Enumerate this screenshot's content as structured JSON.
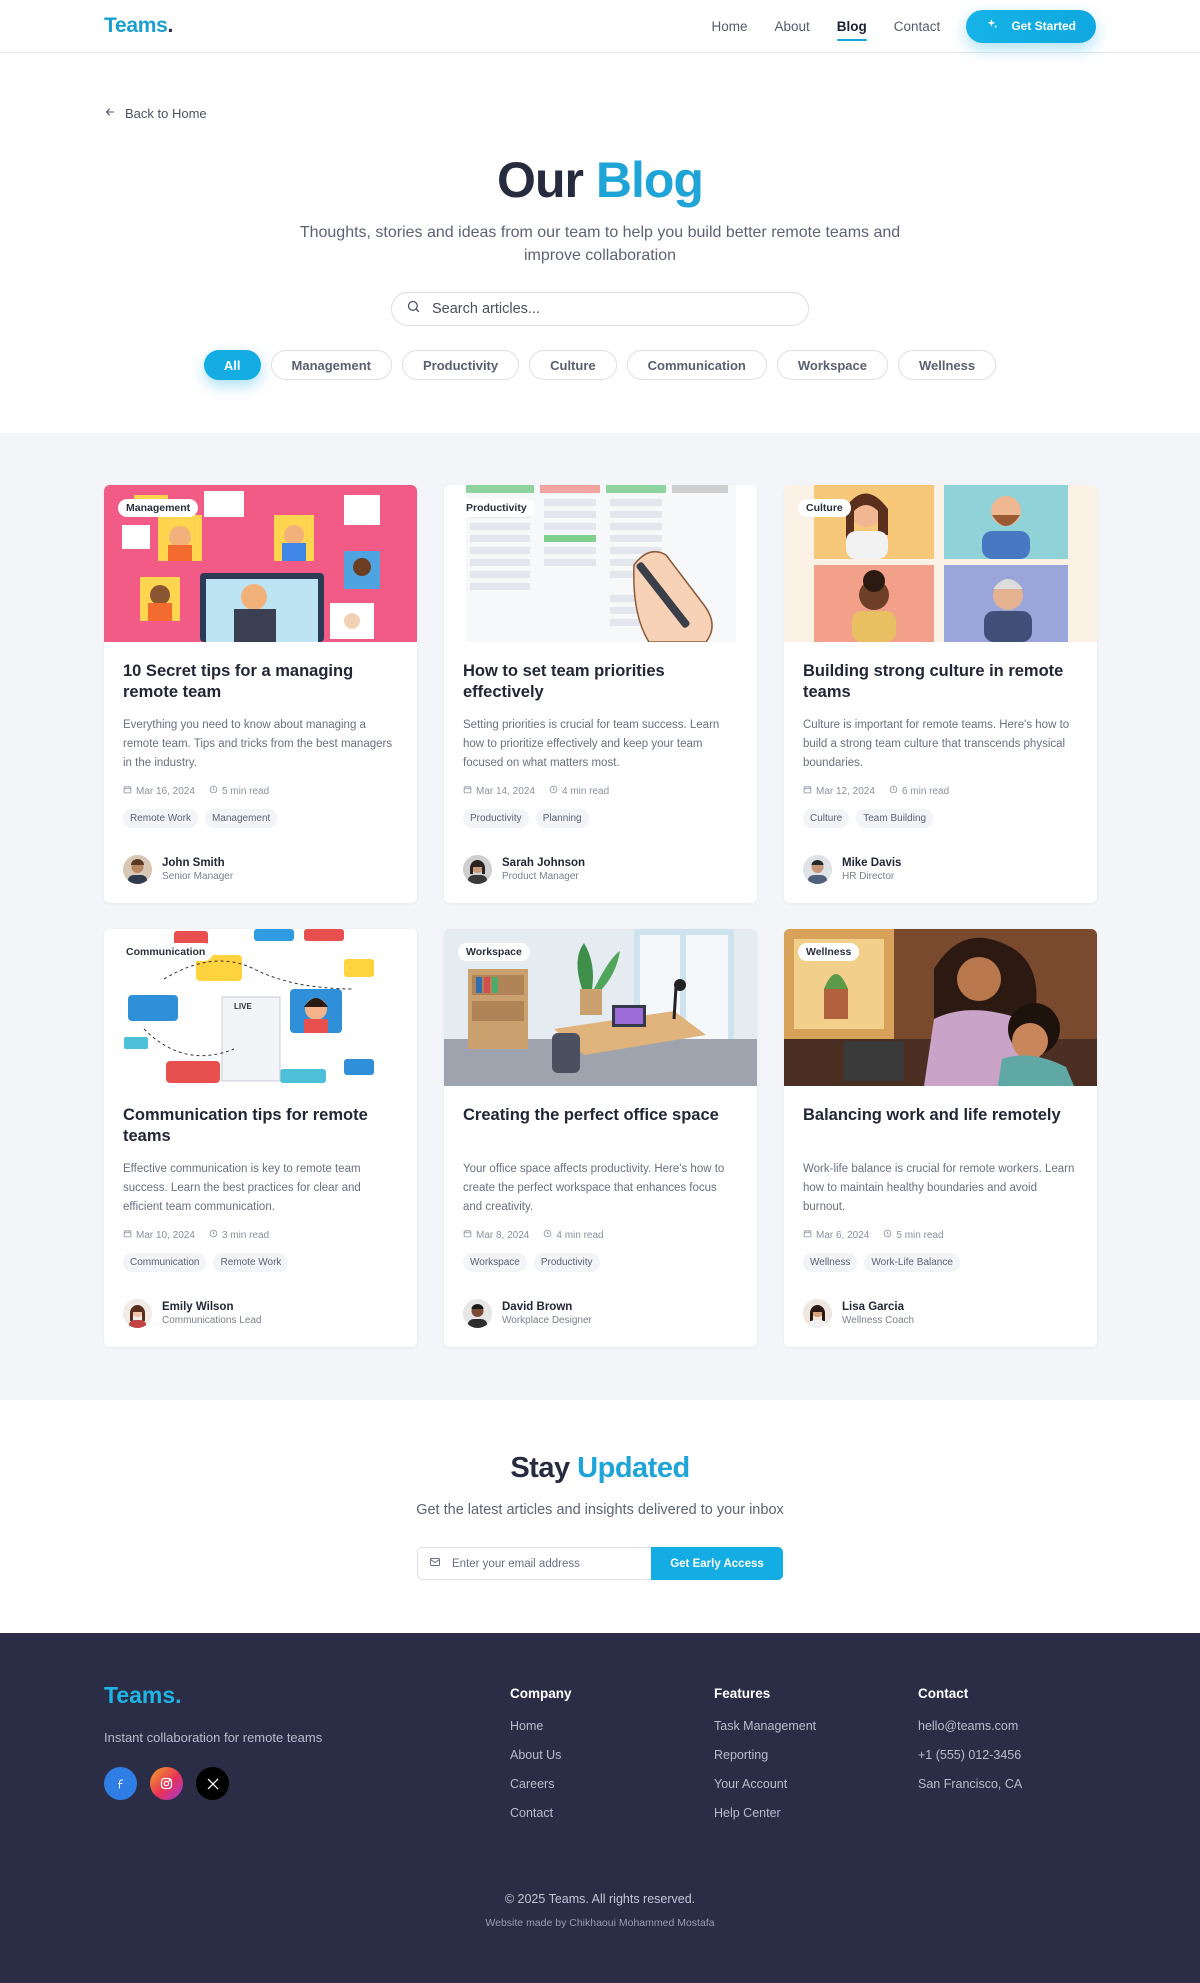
{
  "nav": {
    "logo": "Teams",
    "logo_dot": ".",
    "links": [
      "Home",
      "About",
      "Blog",
      "Contact"
    ],
    "active": "Blog",
    "cta": "Get Started"
  },
  "hero": {
    "back": "Back to Home",
    "title_main": "Our",
    "title_accent": "Blog",
    "subtitle": "Thoughts, stories and ideas from our team to help you build better remote teams and improve collaboration",
    "search_placeholder": "Search articles...",
    "filters": [
      "All",
      "Management",
      "Productivity",
      "Culture",
      "Communication",
      "Workspace",
      "Wellness"
    ],
    "active_filter": "All"
  },
  "posts": [
    {
      "category": "Management",
      "title": "10 Secret tips for a managing remote team",
      "excerpt": "Everything you need to know about managing a remote team. Tips and tricks from the best managers in the industry.",
      "date": "Mar 16, 2024",
      "read": "5 min read",
      "tags": [
        "Remote Work",
        "Management"
      ],
      "author": "John Smith",
      "role": "Senior Manager",
      "thumb_bg": "#f0547e"
    },
    {
      "category": "Productivity",
      "title": "How to set team priorities effectively",
      "excerpt": "Setting priorities is crucial for team success. Learn how to prioritize effectively and keep your team focused on what matters most.",
      "date": "Mar 14, 2024",
      "read": "4 min read",
      "tags": [
        "Productivity",
        "Planning"
      ],
      "author": "Sarah Johnson",
      "role": "Product Manager",
      "thumb_bg": "#ffffff"
    },
    {
      "category": "Culture",
      "title": "Building strong culture in remote teams",
      "excerpt": "Culture is important for remote teams. Here's how to build a strong team culture that transcends physical boundaries.",
      "date": "Mar 12, 2024",
      "read": "6 min read",
      "tags": [
        "Culture",
        "Team Building"
      ],
      "author": "Mike Davis",
      "role": "HR Director",
      "thumb_bg": "#fbe9d6"
    },
    {
      "category": "Communication",
      "title": "Communication tips for remote teams",
      "excerpt": "Effective communication is key to remote team success. Learn the best practices for clear and efficient team communication.",
      "date": "Mar 10, 2024",
      "read": "3 min read",
      "tags": [
        "Communication",
        "Remote Work"
      ],
      "author": "Emily Wilson",
      "role": "Communications Lead",
      "thumb_bg": "#ffffff"
    },
    {
      "category": "Workspace",
      "title": "Creating the perfect office space",
      "excerpt": "Your office space affects productivity. Here's how to create the perfect workspace that enhances focus and creativity.",
      "date": "Mar 8, 2024",
      "read": "4 min read",
      "tags": [
        "Workspace",
        "Productivity"
      ],
      "author": "David Brown",
      "role": "Workplace Designer",
      "thumb_bg": "#dfe8ee"
    },
    {
      "category": "Wellness",
      "title": "Balancing work and life remotely",
      "excerpt": "Work-life balance is crucial for remote workers. Learn how to maintain healthy boundaries and avoid burnout.",
      "date": "Mar 6, 2024",
      "read": "5 min read",
      "tags": [
        "Wellness",
        "Work-Life Balance"
      ],
      "author": "Lisa Garcia",
      "role": "Wellness Coach",
      "thumb_bg": "#7a4a2e"
    }
  ],
  "newsletter": {
    "title_main": "Stay",
    "title_accent": "Updated",
    "subtitle": "Get the latest articles and insights delivered to your inbox",
    "email_placeholder": "Enter your email address",
    "button": "Get Early Access"
  },
  "footer": {
    "logo": "Teams.",
    "tagline": "Instant collaboration for remote teams",
    "columns": [
      {
        "title": "Company",
        "links": [
          "Home",
          "About Us",
          "Careers",
          "Contact"
        ]
      },
      {
        "title": "Features",
        "links": [
          "Task Management",
          "Reporting",
          "Your Account",
          "Help Center"
        ]
      },
      {
        "title": "Contact",
        "links": [
          "hello@teams.com",
          "+1 (555) 012-3456",
          "San Francisco, CA"
        ]
      }
    ],
    "copyright": "© 2025 Teams. All rights reserved.",
    "credit": "Website made by Chikhaoui Mohammed Mostafa"
  },
  "colors": {
    "accent": "#14ade3",
    "text_dark": "#262b3f",
    "footer_bg": "#2b2d46",
    "section_bg": "#f3f5f9"
  }
}
